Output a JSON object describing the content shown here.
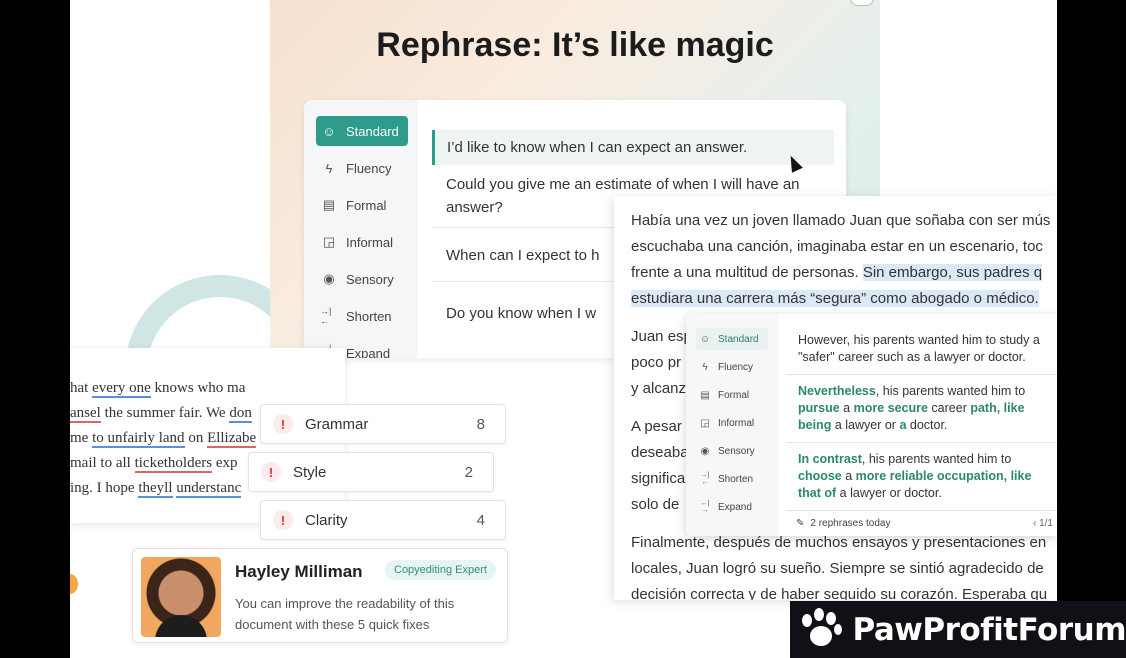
{
  "hero": {
    "title": "Rephrase: It’s like magic"
  },
  "modes": [
    {
      "label": "Standard",
      "icon": "smile-icon",
      "glyph": "☺",
      "active": true
    },
    {
      "label": "Fluency",
      "icon": "bolt-icon",
      "glyph": "ϟ"
    },
    {
      "label": "Formal",
      "icon": "document-icon",
      "glyph": "▤"
    },
    {
      "label": "Informal",
      "icon": "chat-bubbles-icon",
      "glyph": "◲"
    },
    {
      "label": "Sensory",
      "icon": "eye-icon",
      "glyph": "◉"
    },
    {
      "label": "Shorten",
      "icon": "shorten-icon",
      "glyph": "→|←"
    },
    {
      "label": "Expand",
      "icon": "expand-icon",
      "glyph": "←|→"
    }
  ],
  "options": [
    "I’d like to know when I can expect an answer.",
    "Could you give me an estimate of when I will have an answer?",
    "When can I expect to h",
    "Do you know when I w"
  ],
  "doc_lines": [
    [
      "hat ",
      "every one",
      " knows who ma"
    ],
    [
      "ansel",
      " the summer fair. We ",
      "don"
    ],
    [
      "me ",
      "to unfairly land",
      " on ",
      "Ellizabe"
    ],
    [
      "mail to all ",
      "ticketholders",
      " exp"
    ],
    [
      "ing. I hope ",
      "theyll",
      " ",
      "understanc"
    ]
  ],
  "issues": [
    {
      "label": "Grammar",
      "count": "8"
    },
    {
      "label": "Style",
      "count": "2"
    },
    {
      "label": "Clarity",
      "count": "4"
    }
  ],
  "expert": {
    "name": "Hayley Milliman",
    "badge": "Copyediting Expert",
    "message": "You can improve the readability of this document with these 5 quick fixes"
  },
  "spanish": {
    "p1_l1": "Había una vez un joven llamado Juan que soñaba con ser mús",
    "p1_l2": "escuchaba una canción, imaginaba estar en un escenario, toc",
    "p1_l3a": "frente a una multitud de personas. ",
    "p1_l3b": "Sin embargo, sus padres q",
    "p1_l4": "estudiara una carrera más “segura” como abogado o médico.",
    "p2_l1": "Juan esp",
    "p2_l2": "poco pr",
    "p2_l3": "y alcanz",
    "p3_l1": "A pesar",
    "p3_l2": "deseaba",
    "p3_l3": "significa",
    "p3_l4": "solo de",
    "p4_l1": "Finalmente, después de muchos ensayos y presentaciones en",
    "p4_l2": "locales, Juan logró su sueño. Siempre se sintió agradecido de",
    "p4_l3": "decisión correcta y de haber seguido su corazón. Esperaba qu"
  },
  "mini": {
    "opt1_l1": "However, his parents wanted him to study a",
    "opt1_l2": "\"safer\" career such as a lawyer or doctor.",
    "opt2": [
      "Nevertheless",
      ", his parents wanted him to",
      "pursue",
      " a ",
      "more secure",
      " career ",
      "path, like",
      "being",
      " a lawyer or ",
      "a",
      " doctor."
    ],
    "opt3": [
      "In contrast",
      ", his parents wanted him to",
      "choose",
      " a ",
      "more reliable occupation, like",
      "that of",
      " a lawyer or doctor."
    ],
    "footer": "2 rephrases today",
    "page": "‹  1/1"
  },
  "watermark": {
    "text": "PawProfitForum"
  }
}
